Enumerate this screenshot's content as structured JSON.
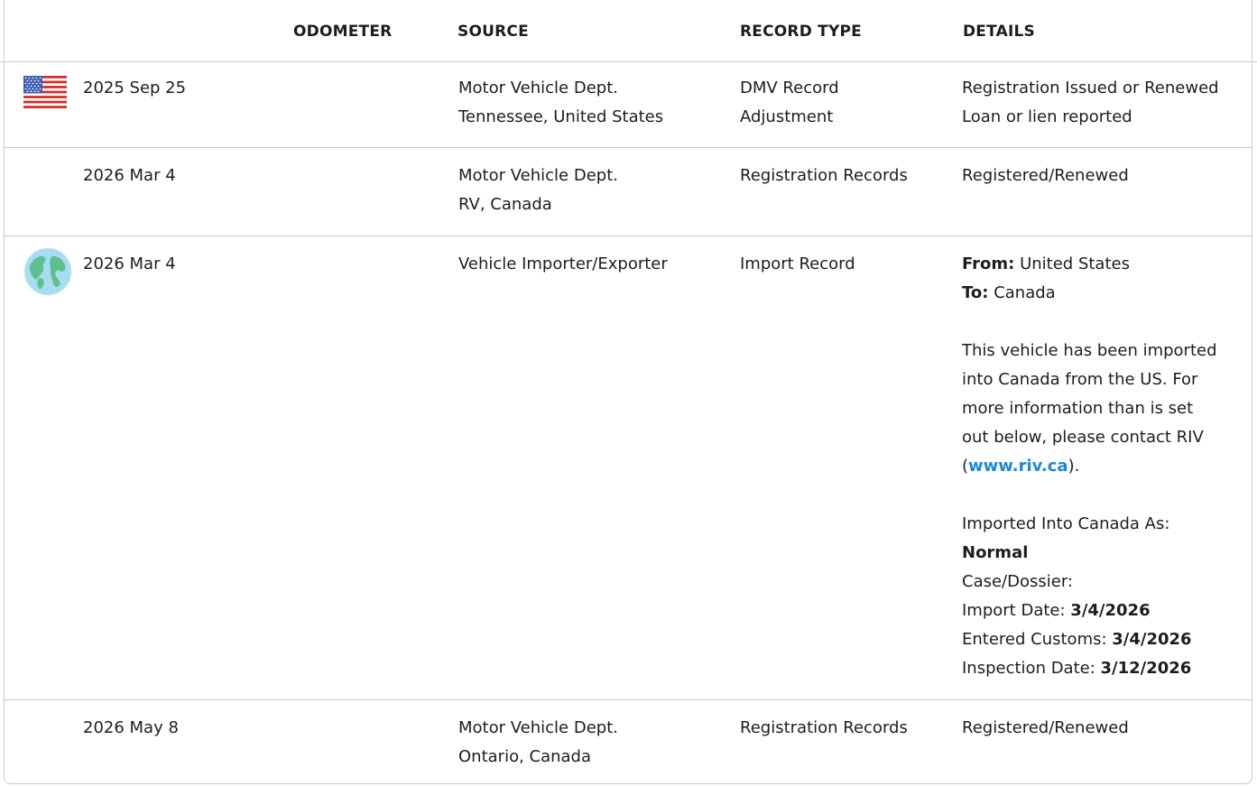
{
  "header": {
    "odometer": "ODOMETER",
    "source": "SOURCE",
    "record_type": "RECORD TYPE",
    "details": "DETAILS"
  },
  "rows": [
    {
      "icon": "us-flag-icon",
      "date": "2025 Sep 25",
      "source": [
        "Motor Vehicle Dept.",
        "Tennessee, United States"
      ],
      "record_type": [
        "DMV Record",
        "Adjustment"
      ],
      "details": [
        "Registration Issued or Renewed",
        "Loan or lien reported"
      ]
    },
    {
      "icon": "",
      "date": "2026 Mar 4",
      "source": [
        "Motor Vehicle Dept.",
        "RV, Canada"
      ],
      "record_type": [
        "Registration Records"
      ],
      "details": [
        "Registered/Renewed"
      ]
    },
    {
      "icon": "globe-icon",
      "date": "2026 Mar 4",
      "source": [
        "Vehicle Importer/Exporter"
      ],
      "record_type": [
        "Import Record"
      ],
      "details": {
        "from_label": "From:",
        "from_value": "United States",
        "to_label": "To:",
        "to_value": "Canada",
        "paragraph": [
          "This vehicle has been imported",
          "into Canada from the US. For",
          "more information than is set",
          "out below, please contact RIV"
        ],
        "paren_open": "(",
        "link": "www.riv.ca",
        "paren_close": ").",
        "imported_as_label": "Imported Into Canada As:",
        "imported_as_value": "Normal",
        "case_label": "Case/Dossier:",
        "import_date_label": "Import Date:",
        "import_date_value": "3/4/2026",
        "entered_customs_label": "Entered Customs:",
        "entered_customs_value": "3/4/2026",
        "inspection_date_label": "Inspection Date:",
        "inspection_date_value": "3/12/2026"
      }
    },
    {
      "icon": "",
      "date": "2026 May 8",
      "source": [
        "Motor Vehicle Dept.",
        "Ontario, Canada"
      ],
      "record_type": [
        "Registration Records"
      ],
      "details": [
        "Registered/Renewed"
      ]
    }
  ],
  "colors": {
    "border": "#c3ccd6",
    "link": "#1e88d6",
    "text": "#1d1d1d"
  }
}
